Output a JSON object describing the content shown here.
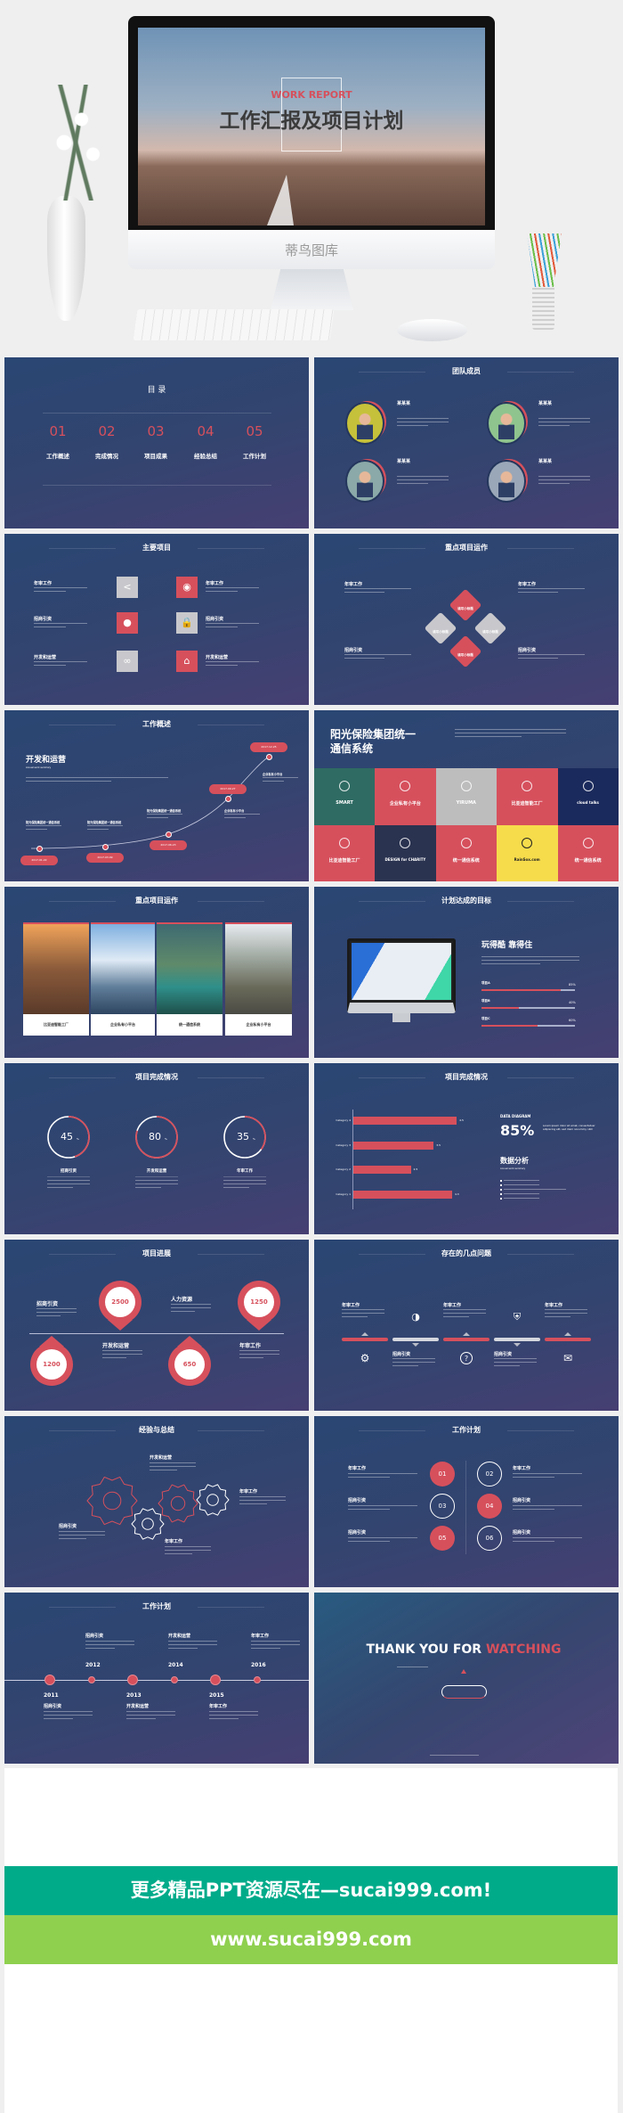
{
  "colors": {
    "accent_red": "#d6505c",
    "slide_bg": "#2f4470",
    "gray_tile": "#c8c8cc",
    "banner_green": "#00ab8a",
    "banner_lime": "#8fd04f"
  },
  "hero": {
    "brand": "蒂鸟图库",
    "screen_tag": "WORK REPORT",
    "screen_title": "工作汇报及项目计划"
  },
  "toc": {
    "title": "目  录",
    "items": [
      {
        "num": "01",
        "label": "工作概述"
      },
      {
        "num": "02",
        "label": "完成情况"
      },
      {
        "num": "03",
        "label": "项目成果"
      },
      {
        "num": "04",
        "label": "经验总结"
      },
      {
        "num": "05",
        "label": "工作计划"
      }
    ]
  },
  "team": {
    "title": "团队成员",
    "members": [
      {
        "name": "某某某",
        "avatar_color": "#c6c13a"
      },
      {
        "name": "某某某",
        "avatar_color": "#8fc48e"
      },
      {
        "name": "某某某",
        "avatar_color": "#8aa9a8"
      },
      {
        "name": "某某某",
        "avatar_color": "#9aa7b8"
      }
    ]
  },
  "main_projects": {
    "title": "主要项目",
    "left": [
      {
        "label": "年审工作",
        "icon": "share-icon",
        "tile": "gray"
      },
      {
        "label": "招商引资",
        "icon": "group-icon",
        "tile": "red"
      },
      {
        "label": "开发和运营",
        "icon": "link-icon",
        "tile": "gray"
      }
    ],
    "right": [
      {
        "label": "年审工作",
        "icon": "disc-icon",
        "tile": "red"
      },
      {
        "label": "招商引资",
        "icon": "lock-icon",
        "tile": "gray"
      },
      {
        "label": "开发和运营",
        "icon": "home-icon",
        "tile": "red"
      }
    ]
  },
  "key_ops": {
    "title": "重点项目运作",
    "left": [
      "年审工作",
      "招商引资"
    ],
    "right": [
      "年审工作",
      "招商引资"
    ],
    "diamond_label": "填写小标题"
  },
  "overview": {
    "title": "工作概述",
    "heading": "开发和运营",
    "heading_en": "Annual work summary",
    "milestones": [
      {
        "date": "2017.01.22",
        "label": "阳光保险集团统一通信系统"
      },
      {
        "date": "2017.03.09",
        "label": "阳光保险集团统一通信系统"
      },
      {
        "date": "2017.06.23",
        "label": "阳光保险集团统一通信系统"
      },
      {
        "date": "2017.09.27",
        "label": "企业私有小平台"
      },
      {
        "date": "2017.12.25",
        "label": "企业私有小平台"
      }
    ]
  },
  "showcase": {
    "title_line1": "阳光保险集团统一",
    "title_line2": "通信系统",
    "tiles": [
      {
        "label": "SMART",
        "bg": "#2f6b63"
      },
      {
        "label": "企业私有小平台",
        "bg": "#d6505c"
      },
      {
        "label": "YIRUMA",
        "bg": "#bdbdbd"
      },
      {
        "label": "比亚迪智能工厂",
        "bg": "#d6505c"
      },
      {
        "label": "cloud talks",
        "bg": "#1b2a5c"
      },
      {
        "label": "比亚迪智能工厂",
        "bg": "#d6505c"
      },
      {
        "label": "DESIGN for CHARITY",
        "bg": "#2a3350"
      },
      {
        "label": "统一通信系统",
        "bg": "#d6505c"
      },
      {
        "label": "RainSox.com",
        "bg": "#f6dc4b"
      },
      {
        "label": "统一通信系统",
        "bg": "#d6505c"
      }
    ]
  },
  "photos": {
    "title": "重点项目运作",
    "cards": [
      {
        "caption": "比亚迪智能工厂"
      },
      {
        "caption": "企业私有小平台"
      },
      {
        "caption": "统一通信系统"
      },
      {
        "caption": "企业私有小平台"
      }
    ]
  },
  "goals": {
    "title": "计划达成的目标",
    "heading": "玩得酷 靠得住",
    "bars": [
      {
        "label": "项目A",
        "value_text": "85%",
        "value": 85
      },
      {
        "label": "项目B",
        "value_text": "40%",
        "value": 40
      },
      {
        "label": "项目C",
        "value_text": "60%",
        "value": 60
      }
    ]
  },
  "rings": {
    "title": "项目完成情况",
    "items": [
      {
        "value": 45,
        "unit": "%",
        "label": "招商引资"
      },
      {
        "value": 80,
        "unit": "%",
        "label": "开发和运营"
      },
      {
        "value": 35,
        "unit": "%",
        "label": "年审工作"
      }
    ]
  },
  "barchart": {
    "title": "项目完成情况",
    "bars": [
      {
        "category": "Category 4",
        "value": 4.5
      },
      {
        "category": "Category 3",
        "value": 3.5
      },
      {
        "category": "Category 2",
        "value": 2.5
      },
      {
        "category": "Category 1",
        "value": 4.3
      }
    ],
    "kicker": "DATA DIAGRAM",
    "big_value": "85%",
    "lorem": "Lorem ipsum dolor sit amet, consectetuer adipiscing elit, sed diam nonummy nibh",
    "heading": "数据分析",
    "heading_en": "Annual work summary"
  },
  "progress": {
    "title": "项目进展",
    "top": [
      {
        "value": "2500"
      },
      {
        "value": "1250"
      }
    ],
    "bottom": [
      {
        "value": "1200"
      },
      {
        "value": "650"
      }
    ],
    "labels": [
      "招商引资",
      "人力资源",
      "开发和运营",
      "年审工作"
    ]
  },
  "issues": {
    "title": "存在的几点问题",
    "top_labels": [
      "年审工作",
      "年审工作",
      "年审工作"
    ],
    "bottom_labels": [
      "招商引资",
      "招商引资"
    ]
  },
  "summary": {
    "title": "经验与总结",
    "labels": [
      "开发和运营",
      "年审工作",
      "招商引资",
      "年审工作"
    ]
  },
  "plan": {
    "title": "工作计划",
    "items": [
      {
        "num": "01",
        "label": "年审工作",
        "filled": true
      },
      {
        "num": "02",
        "label": "年审工作",
        "filled": false
      },
      {
        "num": "03",
        "label": "招商引资",
        "filled": false
      },
      {
        "num": "04",
        "label": "招商引资",
        "filled": true
      },
      {
        "num": "05",
        "label": "招商引资",
        "filled": true
      },
      {
        "num": "06",
        "label": "招商引资",
        "filled": false
      }
    ]
  },
  "timeline": {
    "title": "工作计划",
    "top": [
      {
        "year": "2012",
        "label": "招商引资"
      },
      {
        "year": "2014",
        "label": "开发和运营"
      },
      {
        "year": "2016",
        "label": "年审工作"
      }
    ],
    "bottom": [
      {
        "year": "2011",
        "label": "招商引资"
      },
      {
        "year": "2013",
        "label": "开发和运营"
      },
      {
        "year": "2015",
        "label": "年审工作"
      }
    ]
  },
  "thanks": {
    "white": "THANK YOU FOR ",
    "red": "WATCHING"
  },
  "banner": {
    "line1": "更多精品PPT资源尽在—sucai999.com!",
    "line2": "www.sucai999.com"
  }
}
